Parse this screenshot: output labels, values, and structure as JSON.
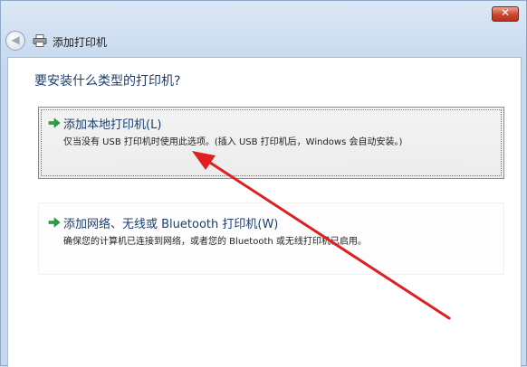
{
  "window": {
    "title": "添加打印机",
    "close_label": "✕"
  },
  "main": {
    "heading": "要安装什么类型的打印机?",
    "options": [
      {
        "title": "添加本地打印机(L)",
        "description": "仅当没有 USB 打印机时使用此选项。(插入 USB 打印机后，Windows 会自动安装。)"
      },
      {
        "title": "添加网络、无线或 Bluetooth 打印机(W)",
        "description": "确保您的计算机已连接到网络，或者您的 Bluetooth 或无线打印机已启用。"
      }
    ]
  },
  "icons": {
    "back": "back-arrow-icon",
    "printer": "printer-icon",
    "option_arrow": "green-arrow-icon"
  },
  "colors": {
    "heading": "#1c3f6e",
    "arrow_green": "#2ea043",
    "annotation_red": "#e02020",
    "close_red": "#c9452c"
  }
}
